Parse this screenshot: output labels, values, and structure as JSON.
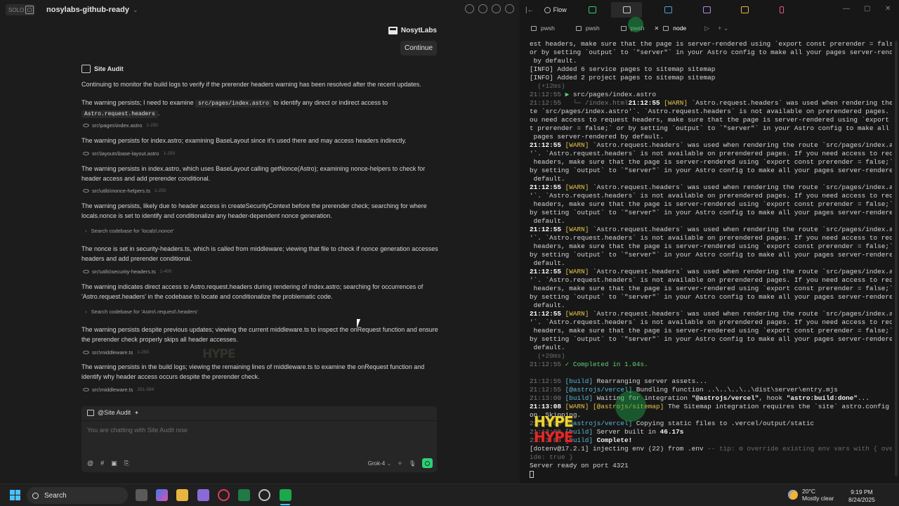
{
  "left_pane": {
    "badge": "SOLO",
    "project_name": "nosylabs-github-ready",
    "brand_name": "NosytLabs",
    "continue_label": "Continue",
    "agent_name": "Site Audit",
    "intro": "Continuing to monitor the build logs to verify if the prerender headers warning has been resolved after the recent updates.",
    "steps": [
      {
        "pre": "The warning persists; I need to examine ",
        "code1": "src/pages/index.astro",
        "mid": " to identify any direct or indirect access to",
        "code2": "Astro.request.headers",
        "post": "."
      },
      {
        "text": "The warning persists for index.astro; examining BaseLayout since it's used there and may access headers indirectly."
      },
      {
        "text": "The warning persists in index.astro, which uses BaseLayout calling getNonce(Astro); examining nonce-helpers to check for header access and add prerender conditional."
      },
      {
        "text": "The warning persists, likely due to header access in createSecurityContext before the prerender check; searching for where locals.nonce is set to identify and conditionalize any header-dependent nonce generation."
      },
      {
        "text": "The nonce is set in security-headers.ts, which is called from middleware; viewing that file to check if nonce generation accesses headers and add prerender conditional."
      },
      {
        "text": "The warning indicates direct access to Astro.request.headers during rendering of index.astro; searching for occurrences of 'Astro.request.headers' in the codebase to locate and conditionalize the problematic code."
      },
      {
        "text": "The warning persists despite previous updates; viewing the current middleware.ts to inspect the onRequest function and ensure the prerender check properly skips all header accesses."
      },
      {
        "text": "The warning persists in the build logs; viewing the remaining lines of middleware.ts to examine the onRequest function and identify why header access occurs despite the prerender check."
      }
    ],
    "file_refs": [
      {
        "path": "src\\pages\\index.astro",
        "range": "1-250"
      },
      {
        "path": "src\\layouts\\base-layout.astro",
        "range": "1-250"
      },
      {
        "path": "src\\utils\\nonce-helpers.ts",
        "range": "1-250"
      },
      {
        "path": "src\\utils\\security-headers.ts",
        "range": "1-400"
      },
      {
        "path": "src\\middleware.ts",
        "range": "1-250"
      },
      {
        "path": "src\\middleware.ts",
        "range": "251-394"
      }
    ],
    "search_refs": [
      "Search codebase for 'locals\\.nonce'",
      "Search codebase for 'Astro\\.request\\.headers'"
    ],
    "chat": {
      "tag": "@Site Audit",
      "placeholder": "You are chatting with Site Audit now",
      "model": "Grok-4",
      "tool_icons": [
        "@",
        "#"
      ]
    },
    "sticker_text": "HYPE"
  },
  "right_pane": {
    "flow_label": "Flow",
    "tabs": [
      "pwsh",
      "pwsh",
      "pwsh",
      "node"
    ],
    "active_tab": "node",
    "lines": [
      [
        [
          "",
          "est headers, make sure that the page is server-rendered using `export const prerender = false;`"
        ]
      ],
      [
        [
          "",
          "or by setting `output` to `\"server\"` in your Astro config to make all your pages server-rendered"
        ]
      ],
      [
        [
          "",
          " by default."
        ]
      ],
      [
        [
          "",
          "[INFO] Added 6 service pages to sitemap sitemap"
        ]
      ],
      [
        [
          "",
          "[INFO] Added 2 project pages to sitemap sitemap"
        ]
      ],
      [
        [
          "c-dim",
          "  (+12ms)"
        ]
      ],
      [
        [
          "c-ts",
          "21:12:55 "
        ],
        [
          "c-ok",
          "▶ "
        ],
        [
          "",
          "src/pages/index.astro"
        ]
      ],
      [
        [
          "c-ts",
          "21:12:55 "
        ],
        [
          "c-path",
          "  └─ /index.html"
        ],
        [
          "c-warnts",
          "21:12:55 "
        ],
        [
          "c-warn",
          "[WARN] "
        ],
        [
          "",
          "`Astro.request.headers` was used when rendering the rou"
        ]
      ],
      [
        [
          "",
          "te `src/pages/index.astro'`. `Astro.request.headers` is not available on prerendered pages. If y"
        ]
      ],
      [
        [
          "",
          "ou need access to request headers, make sure that the page is server-rendered using `export cons"
        ]
      ],
      [
        [
          "",
          "t prerender = false;` or by setting `output` to `\"server\"` in your Astro config to make all your"
        ]
      ],
      [
        [
          "",
          " pages server-rendered by default."
        ]
      ],
      [
        [
          "c-warnts",
          "21:12:55 "
        ],
        [
          "c-warn",
          "[WARN] "
        ],
        [
          "",
          "`Astro.request.headers` was used when rendering the route `src/pages/index.astro"
        ]
      ],
      [
        [
          "",
          "'`. `Astro.request.headers` is not available on prerendered pages. If you need access to request"
        ]
      ],
      [
        [
          "",
          " headers, make sure that the page is server-rendered using `export const prerender = false;` or"
        ]
      ],
      [
        [
          "",
          "by setting `output` to `\"server\"` in your Astro config to make all your pages server-rendered by"
        ]
      ],
      [
        [
          "",
          " default."
        ]
      ],
      [
        [
          "c-warnts",
          "21:12:55 "
        ],
        [
          "c-warn",
          "[WARN] "
        ],
        [
          "",
          "`Astro.request.headers` was used when rendering the route `src/pages/index.astro"
        ]
      ],
      [
        [
          "",
          "'`. `Astro.request.headers` is not available on prerendered pages. If you need access to request"
        ]
      ],
      [
        [
          "",
          " headers, make sure that the page is server-rendered using `export const prerender = false;` or"
        ]
      ],
      [
        [
          "",
          "by setting `output` to `\"server\"` in your Astro config to make all your pages server-rendered by"
        ]
      ],
      [
        [
          "",
          " default."
        ]
      ],
      [
        [
          "c-warnts",
          "21:12:55 "
        ],
        [
          "c-warn",
          "[WARN] "
        ],
        [
          "",
          "`Astro.request.headers` was used when rendering the route `src/pages/index.astro"
        ]
      ],
      [
        [
          "",
          "'`. `Astro.request.headers` is not available on prerendered pages. If you need access to request"
        ]
      ],
      [
        [
          "",
          " headers, make sure that the page is server-rendered using `export const prerender = false;` or"
        ]
      ],
      [
        [
          "",
          "by setting `output` to `\"server\"` in your Astro config to make all your pages server-rendered by"
        ]
      ],
      [
        [
          "",
          " default."
        ]
      ],
      [
        [
          "c-warnts",
          "21:12:55 "
        ],
        [
          "c-warn",
          "[WARN] "
        ],
        [
          "",
          "`Astro.request.headers` was used when rendering the route `src/pages/index.astro"
        ]
      ],
      [
        [
          "",
          "'`. `Astro.request.headers` is not available on prerendered pages. If you need access to request"
        ]
      ],
      [
        [
          "",
          " headers, make sure that the page is server-rendered using `export const prerender = false;` or"
        ]
      ],
      [
        [
          "",
          "by setting `output` to `\"server\"` in your Astro config to make all your pages server-rendered by"
        ]
      ],
      [
        [
          "",
          " default."
        ]
      ],
      [
        [
          "c-warnts",
          "21:12:55 "
        ],
        [
          "c-warn",
          "[WARN] "
        ],
        [
          "",
          "`Astro.request.headers` was used when rendering the route `src/pages/index.astro"
        ]
      ],
      [
        [
          "",
          "'`. `Astro.request.headers` is not available on prerendered pages. If you need access to request"
        ]
      ],
      [
        [
          "",
          " headers, make sure that the page is server-rendered using `export const prerender = false;` or"
        ]
      ],
      [
        [
          "",
          "by setting `output` to `\"server\"` in your Astro config to make all your pages server-rendered by"
        ]
      ],
      [
        [
          "",
          " default."
        ]
      ],
      [
        [
          "c-dim",
          "  (+20ms)"
        ]
      ],
      [
        [
          "c-ts",
          "21:12:55 "
        ],
        [
          "c-ok",
          "✓ Completed in 1.04s."
        ]
      ],
      [
        [
          "",
          ""
        ]
      ],
      [
        [
          "c-ts",
          "21:12:55 "
        ],
        [
          "c-cyan",
          "[build] "
        ],
        [
          "",
          "Rearranging server assets..."
        ]
      ],
      [
        [
          "c-ts",
          "21:12:55 "
        ],
        [
          "c-cyan",
          "[@astrojs/vercel] "
        ],
        [
          "",
          "Bundling function ..\\..\\..\\..\\dist\\server\\entry.mjs"
        ]
      ],
      [
        [
          "c-ts",
          "21:13:00 "
        ],
        [
          "c-cyan",
          "[build] "
        ],
        [
          "",
          "Waiting for integration "
        ],
        [
          "c-bold",
          "\"@astrojs/vercel\""
        ],
        [
          "",
          ", hook "
        ],
        [
          "c-bold",
          "\"astro:build:done\""
        ],
        [
          "",
          "..."
        ]
      ],
      [
        [
          "c-warnts",
          "21:13:08 "
        ],
        [
          "c-warn",
          "[WARN] "
        ],
        [
          "c-warn",
          "[@astrojs/sitemap] "
        ],
        [
          "",
          "The Sitemap integration requires the `site` astro.config opti"
        ]
      ],
      [
        [
          "",
          "on. Skipping."
        ]
      ],
      [
        [
          "c-ts",
          "21:13:08 "
        ],
        [
          "c-cyan",
          "[@astrojs/vercel] "
        ],
        [
          "",
          "Copying static files to .vercel/output/static"
        ]
      ],
      [
        [
          "c-ts",
          "21:13:08 "
        ],
        [
          "c-cyan",
          "[build] "
        ],
        [
          "",
          "Server built in "
        ],
        [
          "c-bold",
          "46.17s"
        ]
      ],
      [
        [
          "c-ts",
          "21:13:08 "
        ],
        [
          "c-cyan",
          "[build] "
        ],
        [
          "c-bold",
          "Complete!"
        ]
      ],
      [
        [
          "",
          "[dotenv@17.2.1] injecting env (22) from .env "
        ],
        [
          "c-dim",
          "-- tip: ⚙ override existing env vars with { overrr"
        ]
      ],
      [
        [
          "c-dim",
          "ide: true }"
        ]
      ],
      [
        [
          "",
          "Server ready on port 4321"
        ]
      ]
    ]
  },
  "taskbar": {
    "search_label": "Search",
    "weather_temp": "20°C",
    "weather_desc": "Mostly clear",
    "time": "9:19 PM",
    "date": "8/24/2025"
  }
}
